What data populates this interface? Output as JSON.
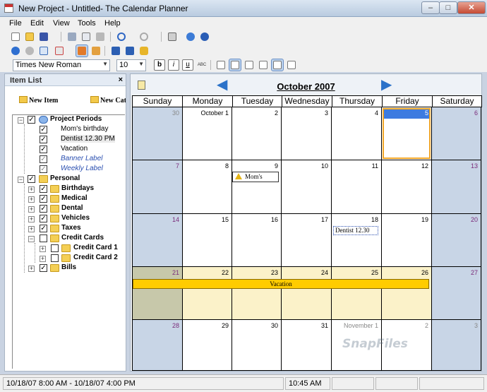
{
  "window": {
    "title": "New Project - Untitled- The Calendar Planner",
    "min": "–",
    "max": "□",
    "close": "✕"
  },
  "menu": [
    "File",
    "Edit",
    "View",
    "Tools",
    "Help"
  ],
  "toolbar": {
    "font": "Times New Roman",
    "size": "10",
    "bold": "b",
    "italic": "i",
    "underline": "u",
    "spell": "ABC"
  },
  "left_pane": {
    "title": "Item List",
    "close": "×",
    "new_item": "New Item",
    "new_cat": "New Cat",
    "tree": [
      {
        "label": "Project Periods",
        "bold": true,
        "checked": true
      },
      {
        "label": "Mom's birthday",
        "checked": true
      },
      {
        "label": "Dentist 12.30 PM",
        "checked": true
      },
      {
        "label": "Vacation",
        "checked": true
      },
      {
        "label": "Banner Label",
        "italic": true,
        "checked": true
      },
      {
        "label": "Weekly Label",
        "italic": true,
        "checked": true
      },
      {
        "label": "Personal",
        "bold": true,
        "checked": true
      },
      {
        "label": "Birthdays",
        "bold": true,
        "checked": true
      },
      {
        "label": "Medical",
        "bold": true,
        "checked": true
      },
      {
        "label": "Dental",
        "bold": true,
        "checked": true
      },
      {
        "label": "Vehicles",
        "bold": true,
        "checked": true
      },
      {
        "label": "Taxes",
        "bold": true,
        "checked": true
      },
      {
        "label": "Credit Cards",
        "bold": true,
        "checked": false
      },
      {
        "label": "Credit Card 1",
        "bold": true,
        "checked": false
      },
      {
        "label": "Credit Card 2",
        "bold": true,
        "checked": false
      },
      {
        "label": "Bills",
        "bold": true,
        "checked": true
      }
    ]
  },
  "calendar": {
    "month": "October 2007",
    "days": [
      "Sunday",
      "Monday",
      "Tuesday",
      "Wednesday",
      "Thursday",
      "Friday",
      "Saturday"
    ],
    "weeks": [
      [
        "30",
        "October 1",
        "2",
        "3",
        "4",
        "5",
        "6"
      ],
      [
        "7",
        "8",
        "9",
        "10",
        "11",
        "12",
        "13"
      ],
      [
        "14",
        "15",
        "16",
        "17",
        "18",
        "19",
        "20"
      ],
      [
        "21",
        "22",
        "23",
        "24",
        "25",
        "26",
        "27"
      ],
      [
        "28",
        "29",
        "30",
        "31",
        "November 1",
        "2",
        "3"
      ]
    ],
    "events": {
      "moms": "Mom's",
      "dentist": "Dentist 12.30",
      "vacation": "Vacation"
    },
    "colors": {
      "weekend": "#c8d5e6",
      "selected": "#f1a628",
      "vacation": "#ffcc00",
      "vacation_week": "#fbf2c9"
    }
  },
  "status": {
    "range": "10/18/07 8:00 AM - 10/18/07 4:00 PM",
    "time": "10:45 AM"
  },
  "watermark": "SnapFiles"
}
